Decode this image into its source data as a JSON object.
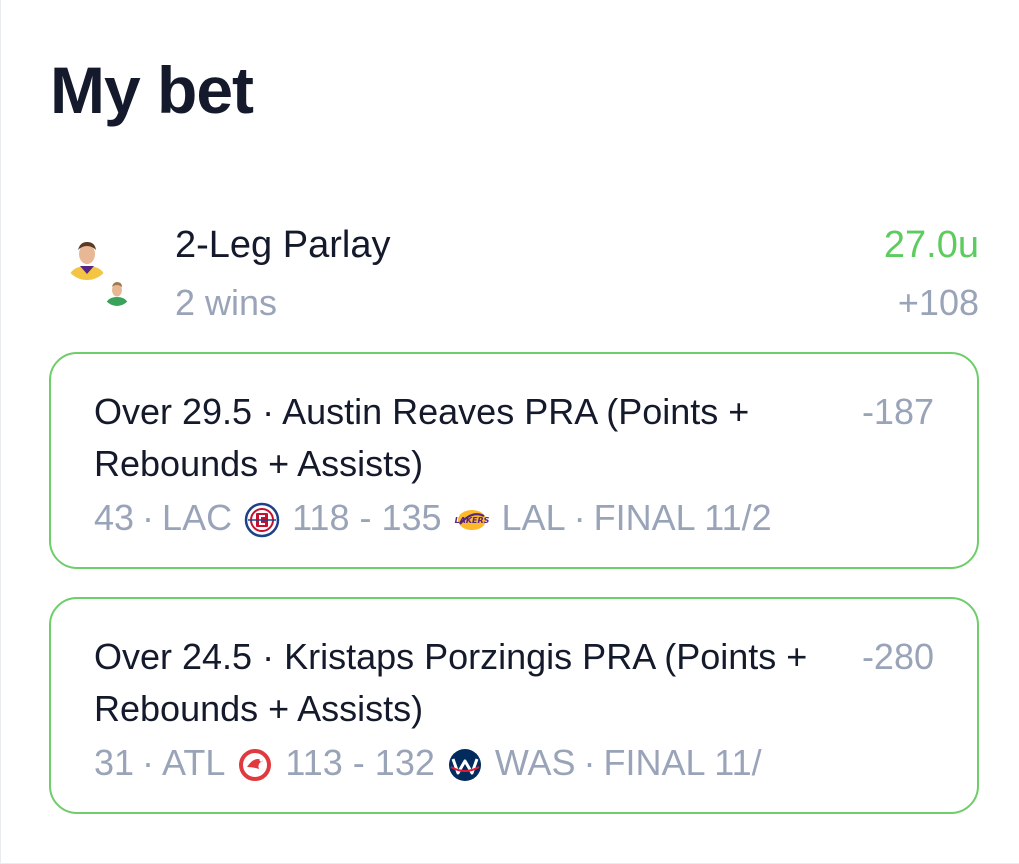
{
  "page": {
    "title": "My bet"
  },
  "parlay": {
    "title": "2-Leg Parlay",
    "subtitle": "2 wins",
    "units": "27.0u",
    "odds": "+108",
    "accent_color": "#5ccc5f"
  },
  "legs": [
    {
      "description": "Over 29.5 · Austin Reaves PRA (Points + Rebounds + Assists)",
      "odds": "-187",
      "stat": "43",
      "away_team": "LAC",
      "away_logo": "clippers-logo-icon",
      "score": "118 - 135",
      "home_logo": "lakers-logo-icon",
      "home_team": "LAL",
      "status": "FINAL 11/2"
    },
    {
      "description": "Over 24.5 · Kristaps Porzingis PRA (Points + Rebounds + Assists)",
      "odds": "-280",
      "stat": "31",
      "away_team": "ATL",
      "away_logo": "hawks-logo-icon",
      "score": "113 - 132",
      "home_logo": "wizards-logo-icon",
      "home_team": "WAS",
      "status": "FINAL 11/"
    }
  ],
  "colors": {
    "win_border": "#6fcd6a",
    "muted_text": "#9aa4b8",
    "primary_text": "#141a2b"
  }
}
